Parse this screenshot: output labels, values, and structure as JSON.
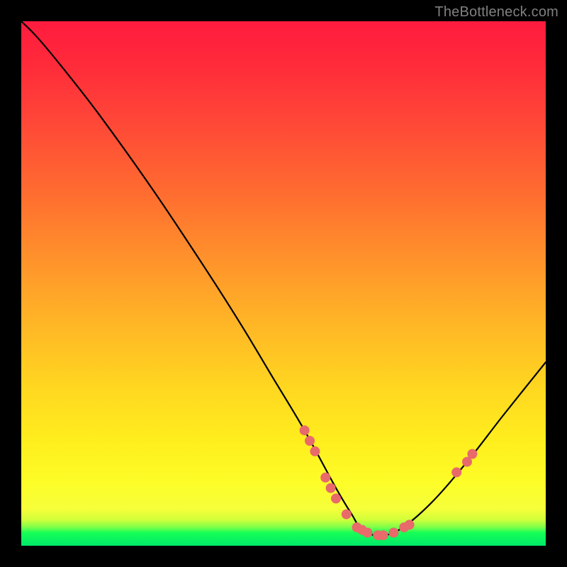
{
  "watermark": "TheBottleneck.com",
  "chart_data": {
    "type": "line",
    "title": "",
    "xlabel": "",
    "ylabel": "",
    "xlim": [
      0,
      100
    ],
    "ylim": [
      0,
      100
    ],
    "series": [
      {
        "name": "bottleneck-curve",
        "x": [
          0,
          3,
          8,
          15,
          25,
          35,
          42,
          48,
          54,
          60,
          63,
          65,
          68,
          72,
          78,
          85,
          92,
          100
        ],
        "values": [
          100,
          97,
          91,
          82,
          68,
          53,
          42,
          32,
          22,
          11,
          6,
          3,
          2,
          3,
          8,
          16,
          25,
          35
        ]
      }
    ],
    "markers": {
      "name": "highlighted-points",
      "color": "#e86a6a",
      "points": [
        {
          "x": 54,
          "y": 22
        },
        {
          "x": 55,
          "y": 20
        },
        {
          "x": 56,
          "y": 18
        },
        {
          "x": 58,
          "y": 13
        },
        {
          "x": 59,
          "y": 11
        },
        {
          "x": 60,
          "y": 9
        },
        {
          "x": 62,
          "y": 6
        },
        {
          "x": 64,
          "y": 3.5
        },
        {
          "x": 65,
          "y": 3
        },
        {
          "x": 66,
          "y": 2.5
        },
        {
          "x": 68,
          "y": 2
        },
        {
          "x": 69,
          "y": 2
        },
        {
          "x": 71,
          "y": 2.5
        },
        {
          "x": 73,
          "y": 3.5
        },
        {
          "x": 74,
          "y": 4
        },
        {
          "x": 83,
          "y": 14
        },
        {
          "x": 85,
          "y": 16
        },
        {
          "x": 86,
          "y": 17.5
        }
      ]
    },
    "gradient_stops": [
      {
        "pos": 0.0,
        "color": "#ff1b3f"
      },
      {
        "pos": 0.45,
        "color": "#ff912b"
      },
      {
        "pos": 0.88,
        "color": "#fdfd28"
      },
      {
        "pos": 1.0,
        "color": "#00e86a"
      }
    ]
  }
}
